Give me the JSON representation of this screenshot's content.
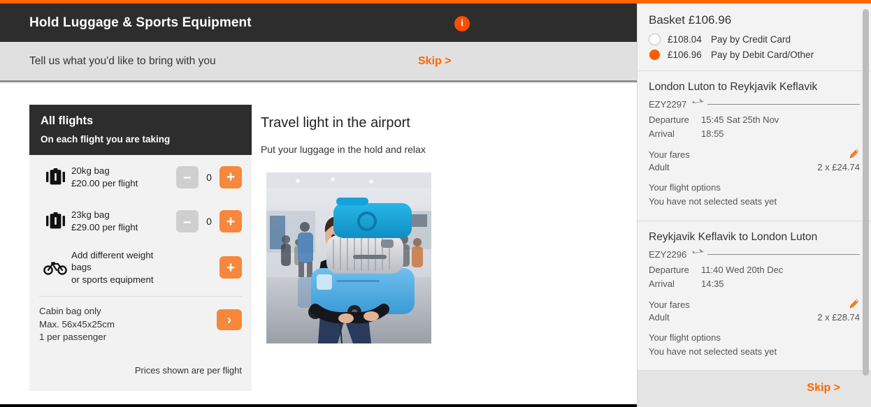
{
  "header": {
    "title": "Hold Luggage & Sports Equipment",
    "info_icon": "info-icon",
    "prompt": "Tell us what you'd like to bring with you",
    "skip_label": "Skip >"
  },
  "flights_card": {
    "title": "All flights",
    "subtitle": "On each flight you are taking",
    "items": [
      {
        "icon": "suitcase-icon",
        "line1": "20kg bag",
        "line2": "£20.00 per flight",
        "minus_label": "–",
        "qty": "0",
        "plus_label": "+"
      },
      {
        "icon": "suitcase-icon",
        "line1": "23kg bag",
        "line2": "£29.00 per flight",
        "minus_label": "–",
        "qty": "0",
        "plus_label": "+"
      },
      {
        "icon": "bicycle-icon",
        "line1": "Add different weight",
        "line2": "bags",
        "line3": "or sports equipment",
        "plus_label": "+"
      }
    ],
    "cabin": {
      "line1": "Cabin bag only",
      "line2": "Max. 56x45x25cm",
      "line3": "1 per passenger",
      "arrow_label": "›"
    },
    "prices_note": "Prices shown are per flight"
  },
  "promo": {
    "heading": "Travel light in the airport",
    "subheading": "Put your luggage in the hold and relax",
    "image_alt": "man-carrying-stacked-suitcases-photo"
  },
  "basket": {
    "title": "Basket £106.96",
    "options": [
      {
        "selected": false,
        "price": "£108.04",
        "label": "Pay by Credit Card"
      },
      {
        "selected": true,
        "price": "£106.96",
        "label": "Pay by Debit Card/Other"
      }
    ]
  },
  "flights": [
    {
      "route": "London Luton to Reykjavik Keflavik",
      "flight_number": "EZY2297",
      "departure_label": "Departure",
      "departure_value": "15:45 Sat 25th Nov",
      "arrival_label": "Arrival",
      "arrival_value": "18:55",
      "fares_title": "Your fares",
      "fare_type": "Adult",
      "fare_value": "2 x £24.74",
      "options_title": "Your flight options",
      "options_value": "You have not selected seats yet",
      "edit_icon": "pencil-icon"
    },
    {
      "route": "Reykjavik Keflavik to London Luton",
      "flight_number": "EZY2296",
      "departure_label": "Departure",
      "departure_value": "11:40 Wed 20th Dec",
      "arrival_label": "Arrival",
      "arrival_value": "14:35",
      "fares_title": "Your fares",
      "fare_type": "Adult",
      "fare_value": "2 x £28.74",
      "options_title": "Your flight options",
      "options_value": "You have not selected seats yet",
      "edit_icon": "pencil-icon"
    }
  ],
  "sidebar_footer": {
    "skip_label": "Skip >"
  },
  "colors": {
    "brand_orange": "#ff6600",
    "button_orange": "#f5883c",
    "dark_header": "#2d2d2d",
    "panel_grey": "#f2f2f2",
    "sidebar_grey": "#f3f3f3"
  }
}
